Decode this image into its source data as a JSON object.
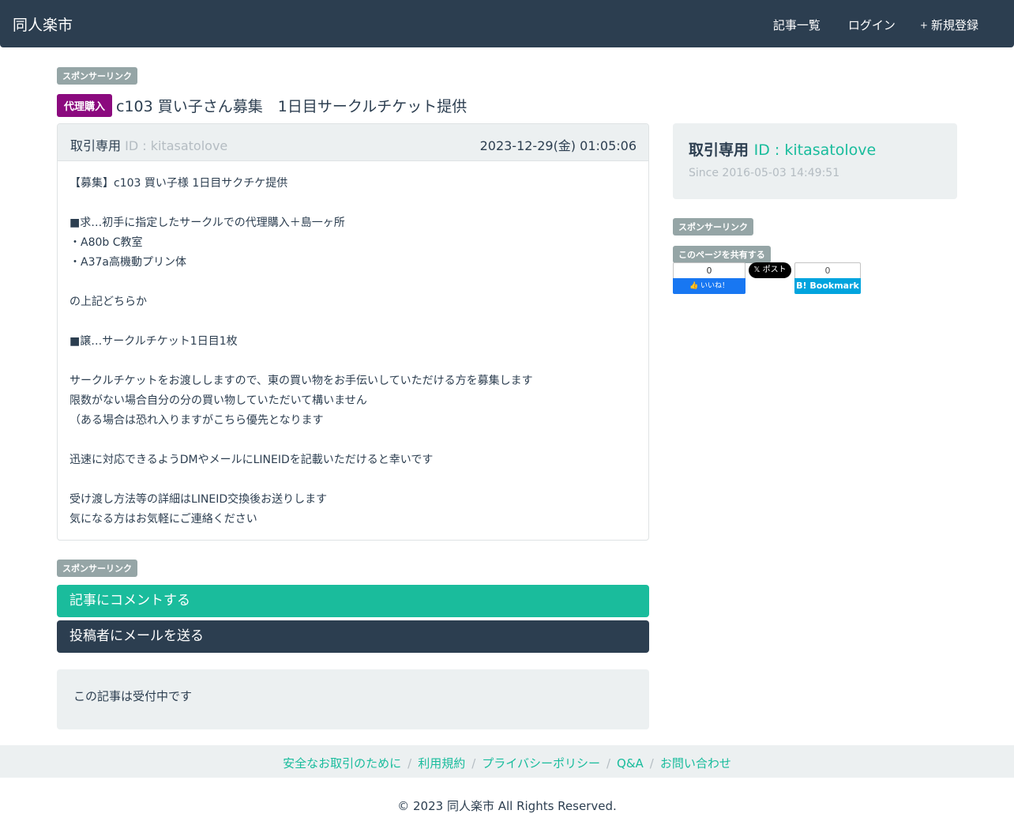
{
  "nav": {
    "brand": "同人楽市",
    "links": [
      {
        "icon": "",
        "label": "記事一覧"
      },
      {
        "icon": "",
        "label": "ログイン"
      },
      {
        "icon": "+",
        "label": "新規登録"
      }
    ]
  },
  "sponsor_label": "スポンサーリンク",
  "post": {
    "category": "代理購入",
    "title": "c103 買い子さん募集　1日目サークルチケット提供",
    "author_icon": "",
    "author_type": "取引専用",
    "author_id": "ID : kitasatolove",
    "date_icon": "",
    "date": "2023-12-29(金) 01:05:06",
    "body_lines": [
      "【募集】c103 買い子様 1日目サクチケ提供",
      "",
      "■求…初手に指定したサークルでの代理購入＋島一ヶ所",
      "・A80b C教室",
      "・A37a高機動プリン体",
      "",
      "の上記どちらか",
      "",
      "■譲…サークルチケット1日目1枚",
      "",
      "サークルチケットをお渡ししますので、東の買い物をお手伝いしていただける方を募集します",
      "限数がない場合自分の分の買い物していただいて構いません",
      "（ある場合は恐れ入りますがこちら優先となります",
      "",
      "迅速に対応できるようDMやメールにLINEIDを記載いただけると幸いです",
      "",
      "受け渡し方法等の詳細はLINEID交換後お送りします",
      "気になる方はお気軽にご連絡ください"
    ]
  },
  "sidebar": {
    "profile_icon": "",
    "profile_type": "取引専用",
    "profile_id": "ID : kitasatolove",
    "since_icon": "",
    "since": "Since 2016-05-03 14:49:51",
    "share_label": "このページを共有する",
    "fb_count": "0",
    "fb_label": "いいね！",
    "x_label": "ポスト",
    "hatena_count": "0",
    "hatena_label": "B! Bookmark"
  },
  "actions": {
    "comment": "記事にコメントする",
    "mail": "投稿者にメールを送る"
  },
  "status": "この記事は受付中です",
  "footer": {
    "links": [
      "安全なお取引のために",
      "利用規約",
      "プライバシーポリシー",
      "Q&A",
      "お問い合わせ"
    ],
    "copyright": "© 2023 同人楽市 All Rights Reserved."
  },
  "colors": {
    "navbar": "#2c3e50",
    "accent": "#18bc9c",
    "category_badge": "#8b0a7e",
    "muted": "#b4bcc2"
  }
}
